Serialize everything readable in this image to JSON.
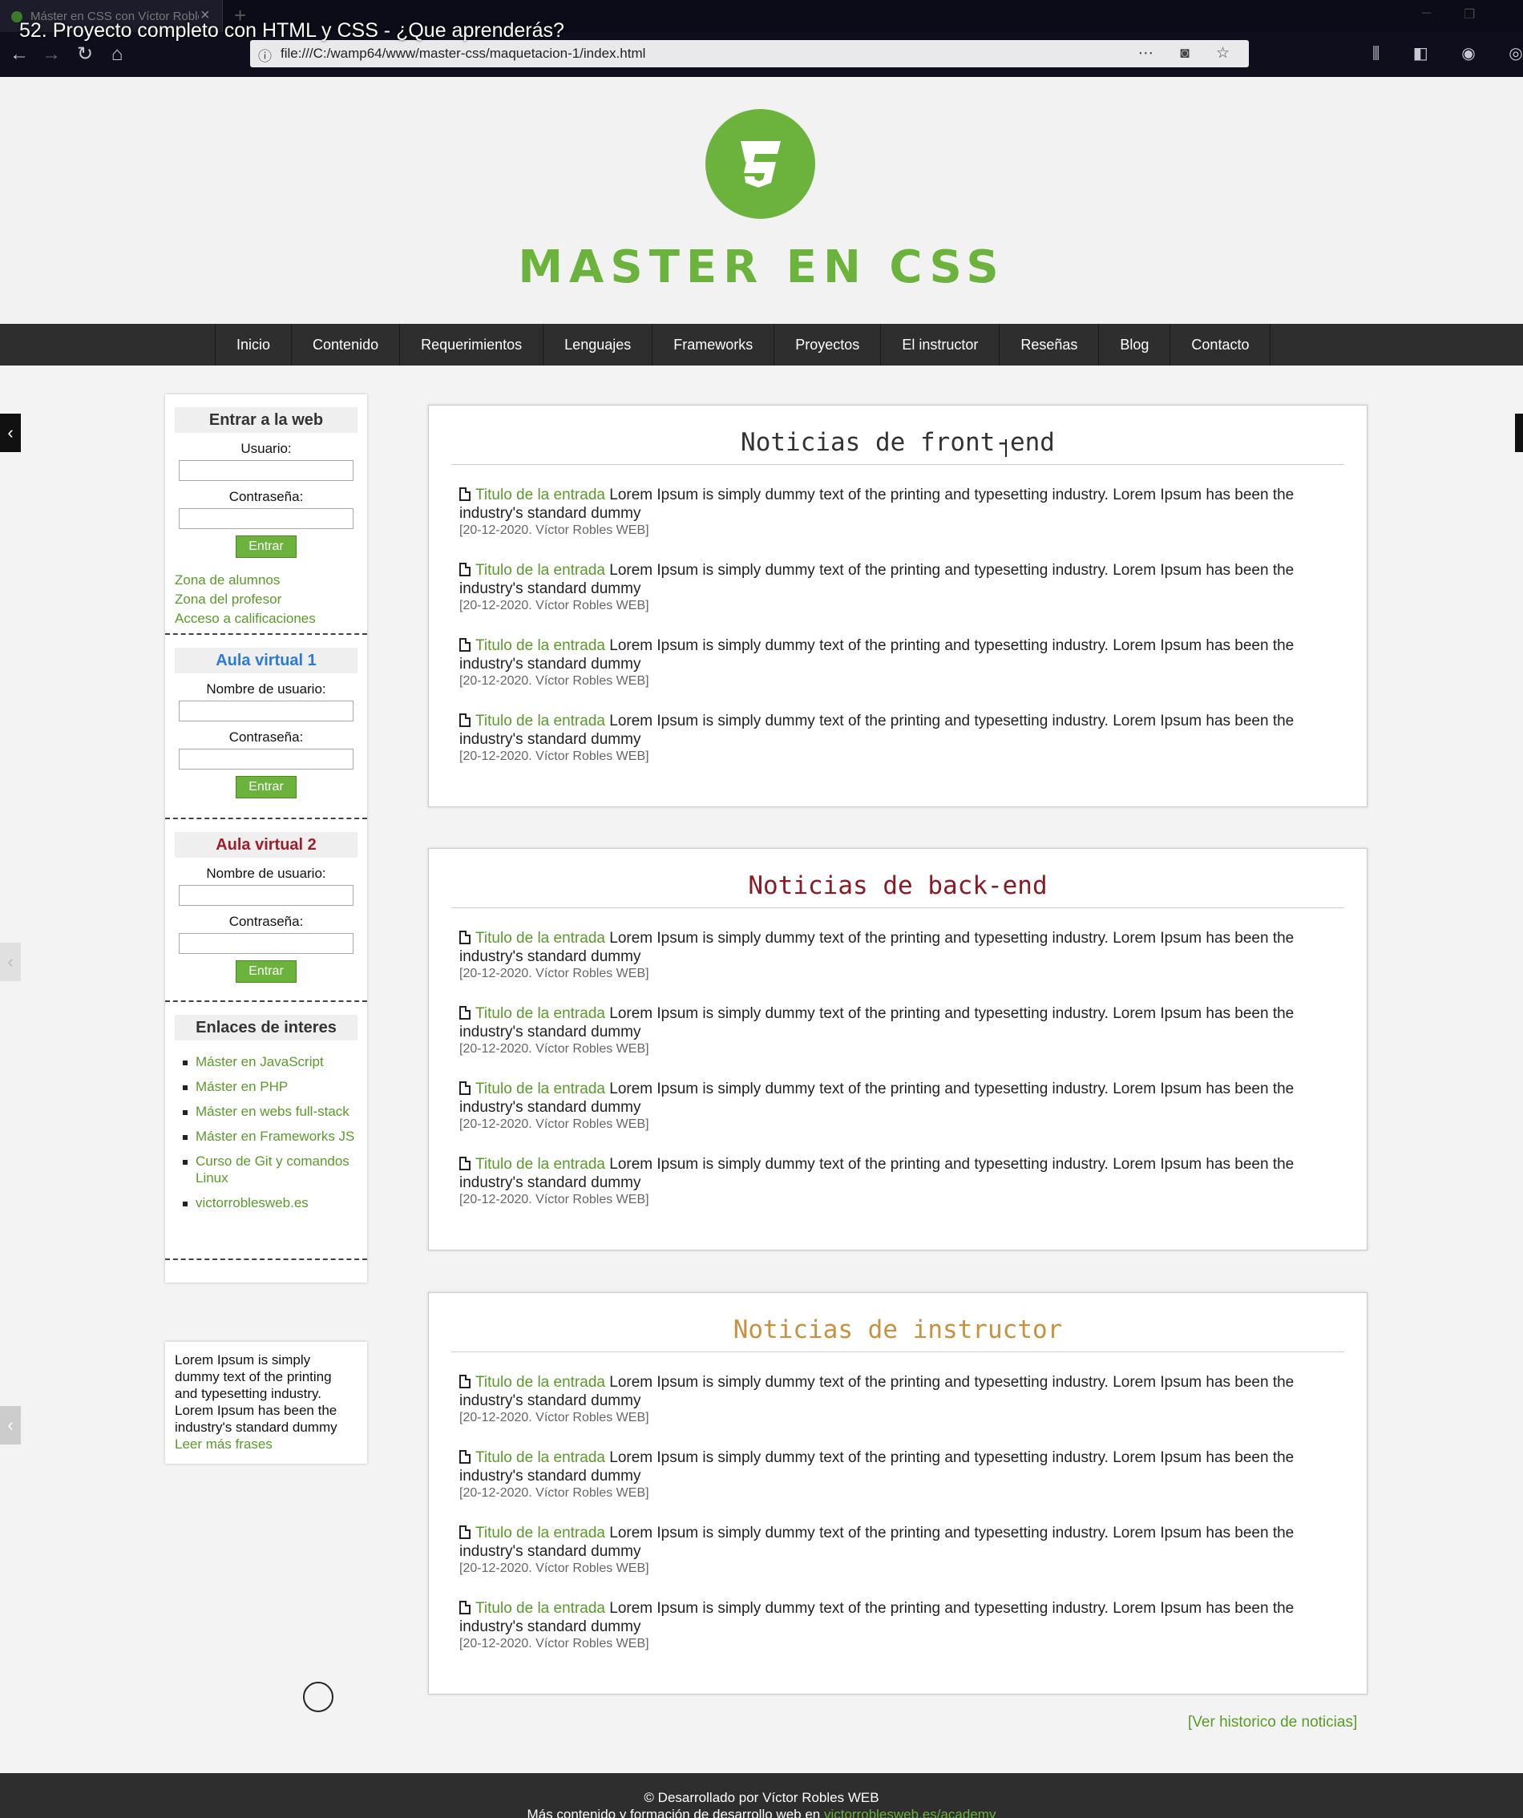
{
  "video": {
    "title": "52. Proyecto completo con HTML y CSS - ¿Que aprenderás?"
  },
  "browser": {
    "tab_label": "Máster en CSS con Víctor Robles",
    "url": "file:///C:/wamp64/www/master-css/maquetacion-1/index.html"
  },
  "header": {
    "logo_text": "MASTER EN CSS"
  },
  "nav": [
    "Inicio",
    "Contenido",
    "Requerimientos",
    "Lenguajes",
    "Frameworks",
    "Proyectos",
    "El instructor",
    "Reseñas",
    "Blog",
    "Contacto"
  ],
  "sidebar": {
    "login": {
      "title": "Entrar a la web",
      "user_label": "Usuario:",
      "pass_label": "Contraseña:",
      "button": "Entrar",
      "links": [
        "Zona de alumnos",
        "Zona del profesor",
        "Acceso a calificaciones"
      ]
    },
    "aula1": {
      "title": "Aula virtual 1",
      "user_label": "Nombre de usuario:",
      "pass_label": "Contraseña:",
      "button": "Entrar"
    },
    "aula2": {
      "title": "Aula virtual 2",
      "user_label": "Nombre de usuario:",
      "pass_label": "Contraseña:",
      "button": "Entrar"
    },
    "interest": {
      "title": "Enlaces de interes",
      "links": [
        "Máster en JavaScript",
        "Máster en PHP",
        "Máster en webs full-stack",
        "Máster en Frameworks JS",
        "Curso de Git y comandos Linux",
        "victorroblesweb.es"
      ]
    },
    "quote": {
      "text": "Lorem Ipsum is simply dummy text of the printing and typesetting industry. Lorem Ipsum has been the industry's standard dummy",
      "link": "Leer más frases"
    }
  },
  "news": {
    "front": {
      "title": "Noticias de front-end"
    },
    "back": {
      "title": "Noticias de back-end"
    },
    "instructor": {
      "title": "Noticias de instructor"
    },
    "item": {
      "link": "Titulo de la entrada",
      "text": " Lorem Ipsum is simply dummy text of the printing and typesetting industry. Lorem Ipsum has been the industry's standard dummy",
      "meta": "[20-12-2020. Víctor Robles WEB]"
    },
    "historico": "[Ver historico de noticias]"
  },
  "footer": {
    "line1": "© Desarrollado por Víctor Robles WEB",
    "line2": "Más contenido y formación de desarrollo web en ",
    "link": "victorroblesweb.es/academy"
  },
  "colors": {
    "green": "#6cb33e",
    "nav_bg": "#2e2e2e",
    "back_title": "#8a1a24",
    "instructor_title": "#c8913e",
    "aula1_title": "#2d7bd4"
  }
}
